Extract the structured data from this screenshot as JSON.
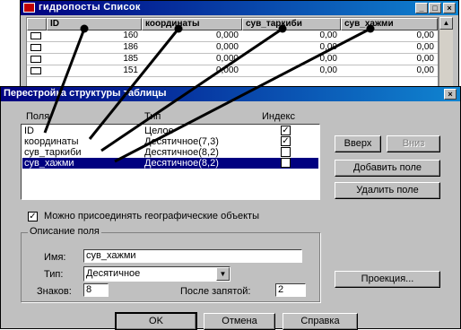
{
  "browser": {
    "title": "гидропосты Список",
    "columns": [
      "ID",
      "координаты",
      "сув_таркиби",
      "сув_хажми"
    ],
    "rows": [
      {
        "id": "160",
        "koord": "0,000",
        "tark": "0,00",
        "hajm": "0,00"
      },
      {
        "id": "186",
        "koord": "0,000",
        "tark": "0,00",
        "hajm": "0,00"
      },
      {
        "id": "185",
        "koord": "0,000",
        "tark": "0,00",
        "hajm": "0,00"
      },
      {
        "id": "151",
        "koord": "0,000",
        "tark": "0,00",
        "hajm": "0,00"
      }
    ],
    "minimize_glyph": "_",
    "maximize_glyph": "□",
    "close_glyph": "×",
    "scroll_up_glyph": "▲"
  },
  "dialog": {
    "title": "Перестройка структуры таблицы",
    "close_glyph": "×",
    "headers": {
      "name": "Поля",
      "type": "Тип",
      "index": "Индекс"
    },
    "fields": [
      {
        "name": "ID",
        "type": "Целое",
        "indexed": true,
        "selected": false
      },
      {
        "name": "координаты",
        "type": "Десятичное(7,3)",
        "indexed": true,
        "selected": false
      },
      {
        "name": "сув_таркиби",
        "type": "Десятичное(8,2)",
        "indexed": false,
        "selected": false
      },
      {
        "name": "сув_хажми",
        "type": "Десятичное(8,2)",
        "indexed": false,
        "selected": true
      }
    ],
    "up_button": "Вверх",
    "down_button": "Вниз",
    "add_field_button": "Добавить поле",
    "delete_field_button": "Удалить поле",
    "geo_checkbox_label": "Можно присоединять географические объекты",
    "geo_checked": true,
    "description_group": "Описание поля",
    "name_label": "Имя:",
    "name_value": "сув_хажми",
    "type_label": "Тип:",
    "type_value": "Десятичное",
    "digits_label": "Знаков:",
    "digits_value": "8",
    "decimals_label": "После запятой:",
    "decimals_value": "2",
    "projection_button": "Проекция...",
    "ok_button": "OK",
    "cancel_button": "Отмена",
    "help_button": "Справка",
    "check_glyph": "✓",
    "combo_arrow_glyph": "▼"
  }
}
